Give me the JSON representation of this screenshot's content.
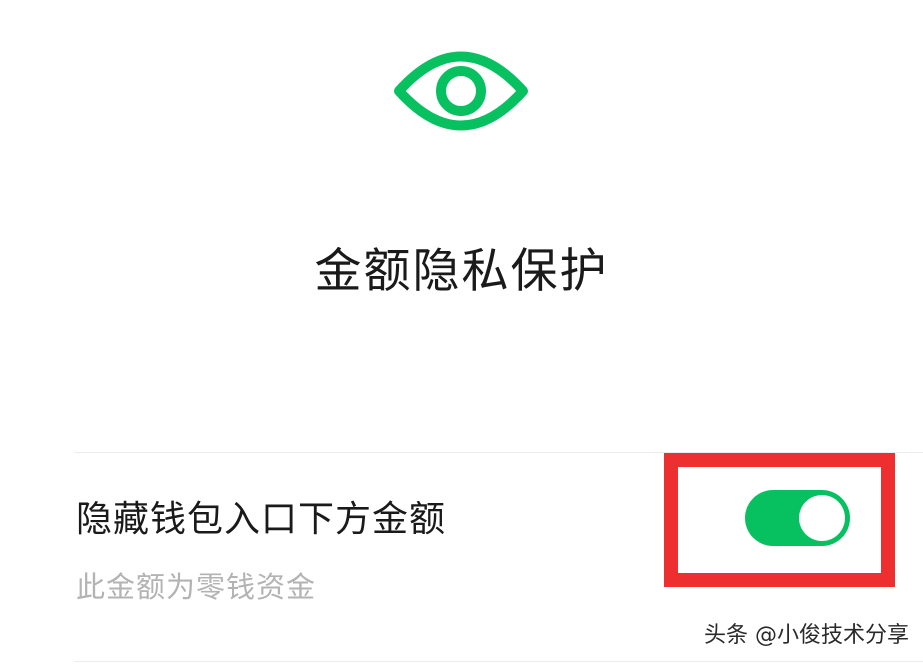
{
  "header": {
    "icon": "eye-icon",
    "title": "金额隐私保护"
  },
  "setting": {
    "label": "隐藏钱包入口下方金额",
    "description": "此金额为零钱资金",
    "toggle_on": true
  },
  "watermark": {
    "text": "头条 @小俊技术分享"
  },
  "colors": {
    "accent": "#07c160",
    "highlight": "#ee2f2f",
    "title_text": "#1a1a1a",
    "secondary_text": "#b3b3b3"
  }
}
